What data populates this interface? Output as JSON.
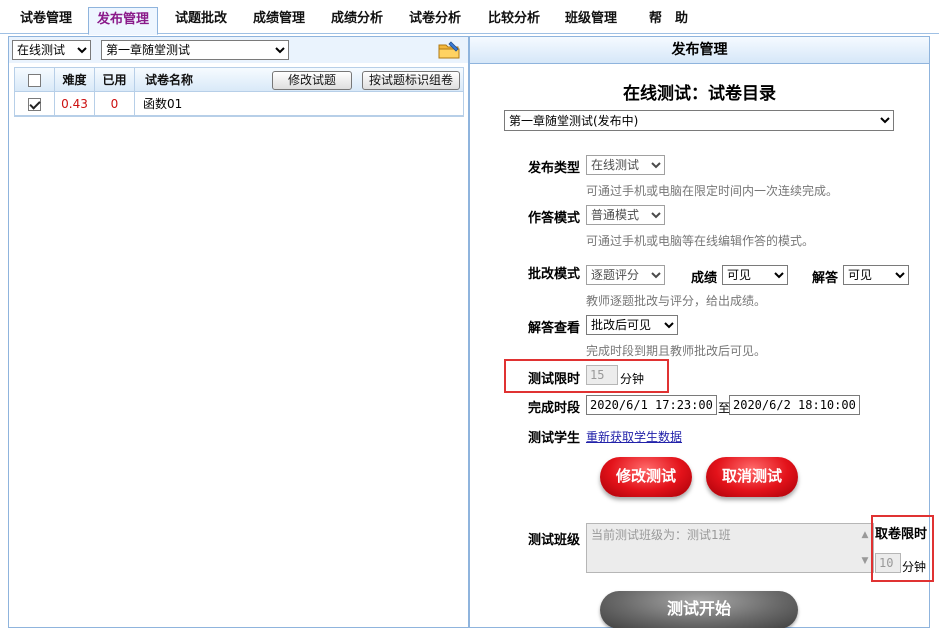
{
  "nav": {
    "tabs": [
      "试卷管理",
      "发布管理",
      "试题批改",
      "成绩管理",
      "成绩分析",
      "试卷分析",
      "比较分析",
      "班级管理",
      "帮　助"
    ],
    "active_index": 1
  },
  "left": {
    "mode_select": "在线测试",
    "paper_select": "第一章随堂测试",
    "folder_icon": "folder-edit-icon",
    "grid": {
      "headers": {
        "difficulty": "难度",
        "used": "已用",
        "name": "试卷名称"
      },
      "edit_button": "修改试题",
      "tag_button": "按试题标识组卷",
      "rows": [
        {
          "checked": true,
          "difficulty": "0.43",
          "used": "0",
          "name": "函数01"
        }
      ]
    }
  },
  "right": {
    "header": "发布管理",
    "title": "在线测试：试卷目录",
    "paper_status_select": "第一章随堂测试(发布中)",
    "publish_type": {
      "label": "发布类型",
      "value": "在线测试",
      "hint": "可通过手机或电脑在限定时间内一次连续完成。"
    },
    "answer_mode": {
      "label": "作答模式",
      "value": "普通模式",
      "hint": "可通过手机或电脑等在线编辑作答的模式。"
    },
    "grading_mode": {
      "label": "批改模式",
      "value": "逐题评分",
      "hint": "教师逐题批改与评分，给出成绩。",
      "score_label": "成绩",
      "score_value": "可见",
      "answer_label": "解答",
      "answer_value": "可见"
    },
    "answer_view": {
      "label": "解答查看",
      "value": "批改后可见",
      "hint": "完成时段到期且教师批改后可见。"
    },
    "time_limit": {
      "label": "测试限时",
      "value": "15",
      "unit": "分钟"
    },
    "period": {
      "label": "完成时段",
      "start": "2020/6/1 17:23:00",
      "sep": "至",
      "end": "2020/6/2 18:10:00"
    },
    "students": {
      "label": "测试学生",
      "link": "重新获取学生数据"
    },
    "modify_button": "修改测试",
    "cancel_button": "取消测试",
    "class": {
      "label": "测试班级",
      "text": "当前测试班级为：测试1班"
    },
    "fetch_limit": {
      "label": "取卷限时",
      "value": "10",
      "unit": "分钟"
    },
    "start_button": "测试开始"
  },
  "colors": {
    "accent_red": "#e03232",
    "active_tab": "#8a1a8a",
    "border_blue": "#8fb4dd"
  }
}
